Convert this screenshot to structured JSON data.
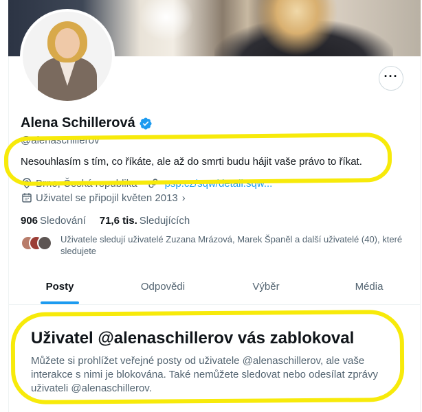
{
  "profile": {
    "name": "Alena Schillerová",
    "handle": "@alenaschillerov",
    "bio": "Nesouhlasím s tím, co říkáte, ale až do smrti budu hájit vaše právo to říkat.",
    "location": "Brno, Česká republika",
    "website": "psp.cz/sqw/detail.sqw...",
    "joined": "Uživatel se připojil květen 2013",
    "following_count": "906",
    "following_label": "Sledování",
    "followers_count": "71,6 tis.",
    "followers_label": "Sledujících",
    "followed_by_text": "Uživatele sledují uživatelé Zuzana Mrázová, Marek Španěl a další uživatelé (40), které sledujete"
  },
  "icons": {
    "more": "more-icon",
    "verified": "verified-badge-icon",
    "location": "location-pin-icon",
    "link": "link-icon",
    "calendar": "calendar-icon",
    "chevron": "chevron-right-icon"
  },
  "tabs": [
    {
      "label": "Posty",
      "active": true
    },
    {
      "label": "Odpovědi",
      "active": false
    },
    {
      "label": "Výběr",
      "active": false
    },
    {
      "label": "Média",
      "active": false
    }
  ],
  "blocked": {
    "title": "Uživatel @alenaschillerov vás zablokoval",
    "text": "Můžete si prohlížet veřejné posty od uživatele @alenaschillerov, ale vaše interakce s nimi je blokována. Také nemůžete sledovat nebo odesílat zprávy uživateli @alenaschillerov."
  },
  "colors": {
    "accent": "#1d9bf0",
    "highlight": "#f7ea0a",
    "secondary_text": "#536471"
  }
}
